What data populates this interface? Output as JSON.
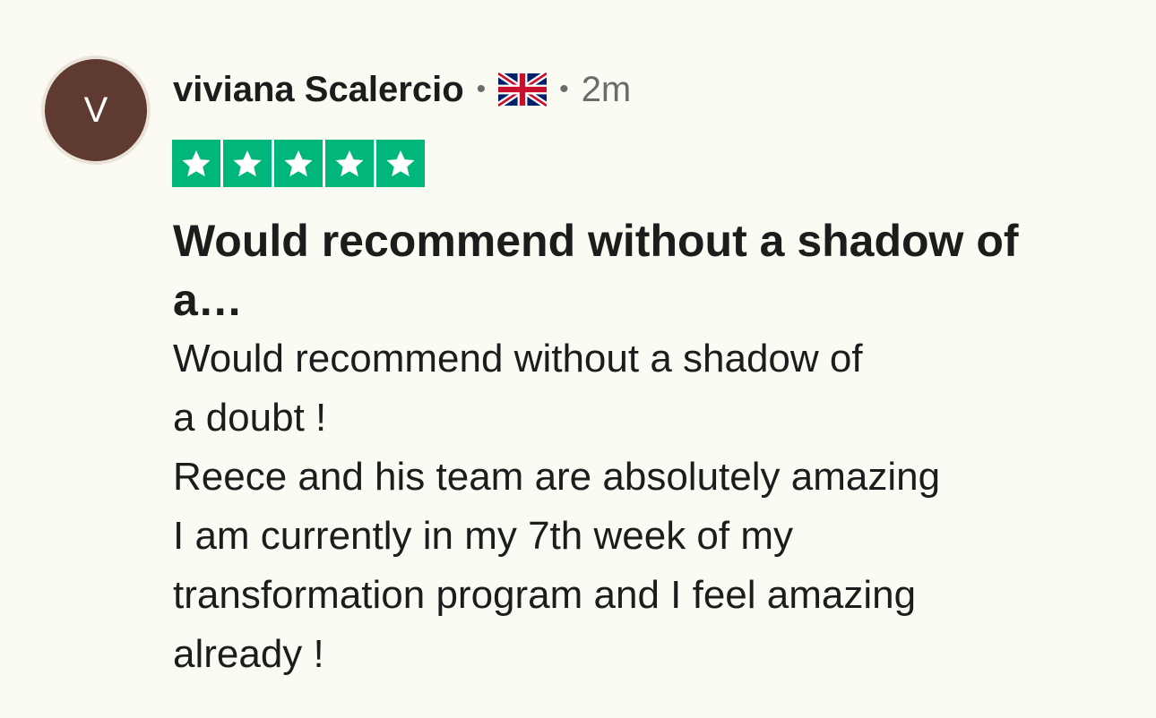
{
  "reviewer": {
    "initial": "V",
    "name": "viviana Scalercio",
    "separator": "•",
    "country_flag_icon": "uk-flag-icon",
    "time_ago": "2m"
  },
  "rating": {
    "stars": 5,
    "max_stars": 5,
    "color": "#00b67a"
  },
  "review": {
    "title": "Would recommend without a shadow of a…",
    "body_lines": [
      "Would recommend without a shadow of",
      "a doubt !",
      "Reece and his team are absolutely amazing",
      "I am currently in my 7th week of my",
      "transformation program and I feel amazing",
      "already !"
    ]
  },
  "colors": {
    "background": "#fbfaf3",
    "avatar_bg": "#5e3a30",
    "text": "#1c1c1c",
    "muted": "#6b6b6b"
  }
}
